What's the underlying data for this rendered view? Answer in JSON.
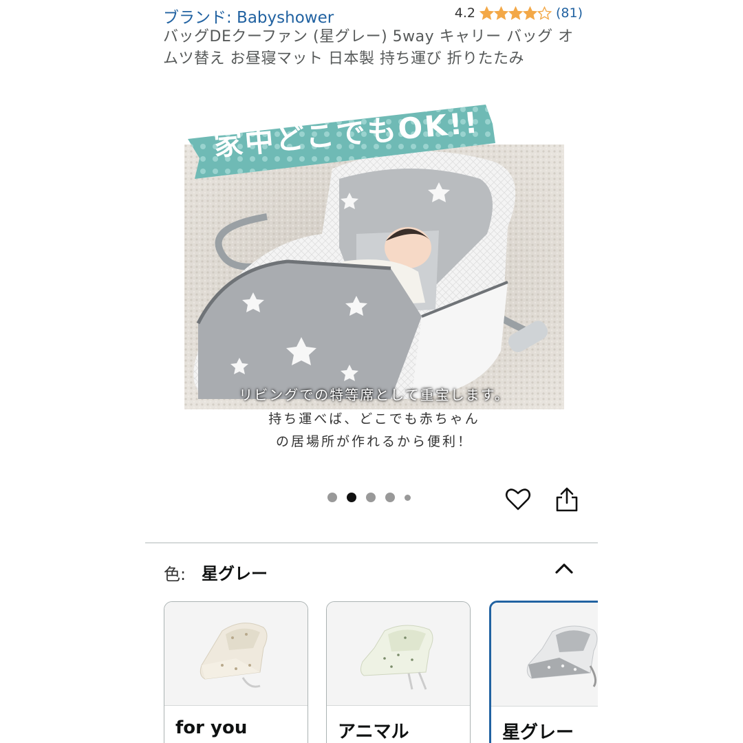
{
  "header": {
    "brand_link": "ブランド: Babyshower",
    "rating_score": "4.2",
    "rating_value": 4.2,
    "rating_max": 5,
    "rating_count": "(81)"
  },
  "product": {
    "title": "バッグDEクーファン (星グレー) 5way キャリー バッグ オムツ替え お昼寝マット 日本製 持ち運び 折りたたみ"
  },
  "gallery": {
    "banner_text": "家中どこでもOK!!",
    "caption_line1": "リビングでの特等席として重宝します。",
    "caption_line2": "持ち運べば、どこでも赤ちゃん",
    "caption_line3": "の居場所が作れるから便利！",
    "page_count": 5,
    "active_index": 1,
    "colors": {
      "banner": "#7fc4c0",
      "accent_star": "#f3a847",
      "link": "#2162a1"
    }
  },
  "actions": {
    "heart_icon": "heart-icon",
    "share_icon": "share-icon"
  },
  "color_selector": {
    "label": "色:",
    "selected_value": "星グレー",
    "toggle_icon": "chevron-up-icon",
    "options": [
      {
        "label": "for you"
      },
      {
        "label": "アニマル"
      },
      {
        "label": "星グレー"
      }
    ]
  }
}
